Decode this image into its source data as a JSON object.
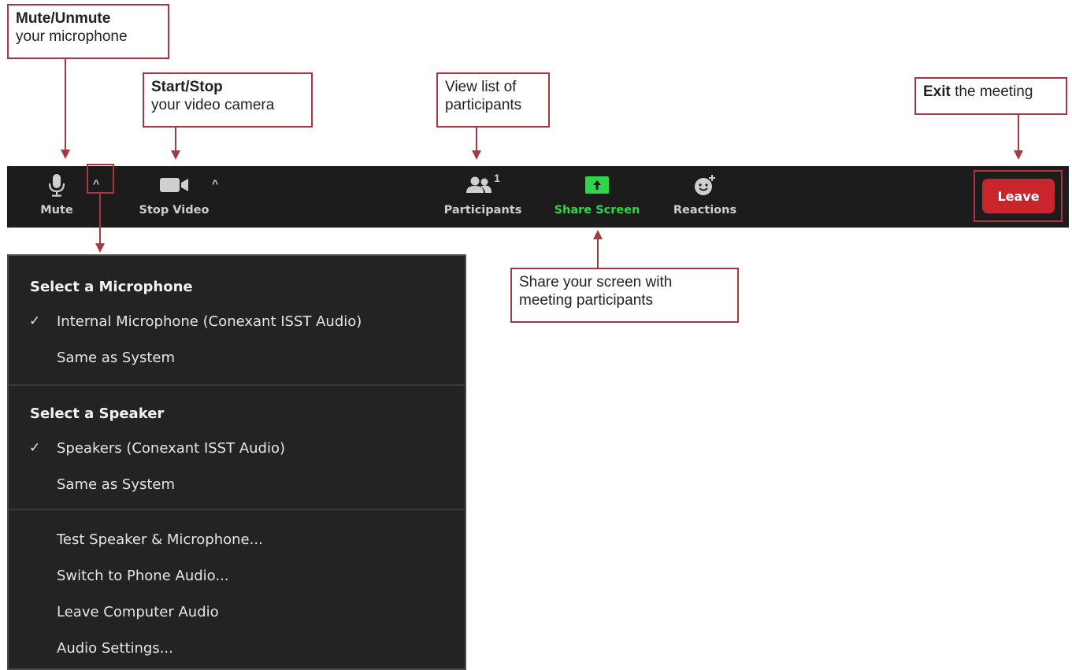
{
  "callouts": {
    "mute": {
      "bold": "Mute/Unmute",
      "text": "your microphone"
    },
    "video": {
      "bold": "Start/Stop",
      "text": "your video camera"
    },
    "participants": {
      "line1": "View list of",
      "line2": "participants"
    },
    "exit": {
      "bold": "Exit",
      "text": " the meeting"
    },
    "share": {
      "line1": "Share your screen with",
      "line2": "meeting participants"
    }
  },
  "toolbar": {
    "mute_label": "Mute",
    "stop_video_label": "Stop Video",
    "participants_label": "Participants",
    "participants_count": "1",
    "share_screen_label": "Share Screen",
    "reactions_label": "Reactions",
    "leave_label": "Leave",
    "caret_glyph": "^"
  },
  "colors": {
    "callout_border": "#a63841",
    "toolbar_bg": "#1c1c1c",
    "share_green": "#2fd64a",
    "leave_red": "#c9252c",
    "menu_bg": "#232323"
  },
  "menu": {
    "microphone_heading": "Select a Microphone",
    "microphone_items": [
      {
        "label": "Internal Microphone (Conexant ISST Audio)",
        "checked": true
      },
      {
        "label": "Same as System",
        "checked": false
      }
    ],
    "speaker_heading": "Select a Speaker",
    "speaker_items": [
      {
        "label": "Speakers (Conexant ISST Audio)",
        "checked": true
      },
      {
        "label": "Same as System",
        "checked": false
      }
    ],
    "action_items": [
      {
        "label": "Test Speaker & Microphone..."
      },
      {
        "label": "Switch to Phone Audio..."
      },
      {
        "label": "Leave Computer Audio"
      },
      {
        "label": "Audio Settings..."
      }
    ],
    "check_glyph": "✓"
  }
}
